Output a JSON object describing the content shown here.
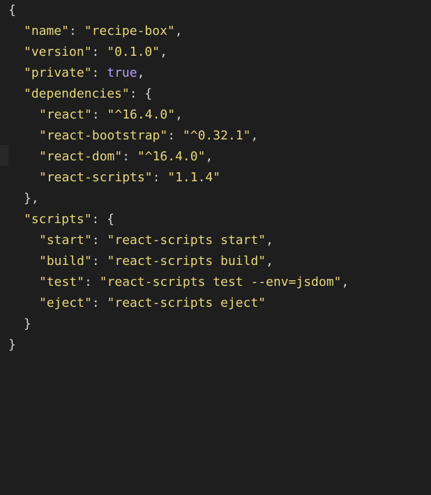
{
  "file": {
    "lines": [
      {
        "type": "brace_open",
        "text": "{"
      },
      {
        "type": "pair",
        "indent": 1,
        "key": "\"name\"",
        "value": "\"recipe-box\"",
        "comma": true
      },
      {
        "type": "pair",
        "indent": 1,
        "key": "\"version\"",
        "value": "\"0.1.0\"",
        "comma": true
      },
      {
        "type": "pair_bool",
        "indent": 1,
        "key": "\"private\"",
        "value": "true",
        "comma": true
      },
      {
        "type": "obj_open",
        "indent": 1,
        "key": "\"dependencies\""
      },
      {
        "type": "pair",
        "indent": 2,
        "key": "\"react\"",
        "value": "\"^16.4.0\"",
        "comma": true
      },
      {
        "type": "pair",
        "indent": 2,
        "key": "\"react-bootstrap\"",
        "value": "\"^0.32.1\"",
        "comma": true
      },
      {
        "type": "pair",
        "indent": 2,
        "key": "\"react-dom\"",
        "value": "\"^16.4.0\"",
        "comma": true
      },
      {
        "type": "pair",
        "indent": 2,
        "key": "\"react-scripts\"",
        "value": "\"1.1.4\"",
        "comma": false
      },
      {
        "type": "obj_close",
        "indent": 1,
        "text": "},",
        "comma": true
      },
      {
        "type": "obj_open",
        "indent": 1,
        "key": "\"scripts\""
      },
      {
        "type": "pair",
        "indent": 2,
        "key": "\"start\"",
        "value": "\"react-scripts start\"",
        "comma": true
      },
      {
        "type": "pair",
        "indent": 2,
        "key": "\"build\"",
        "value": "\"react-scripts build\"",
        "comma": true
      },
      {
        "type": "pair",
        "indent": 2,
        "key": "\"test\"",
        "value": "\"react-scripts test --env=jsdom\"",
        "comma": true
      },
      {
        "type": "pair",
        "indent": 2,
        "key": "\"eject\"",
        "value": "\"react-scripts eject\"",
        "comma": false
      },
      {
        "type": "obj_close",
        "indent": 1,
        "text": "}",
        "comma": false
      },
      {
        "type": "brace_close",
        "text": "}"
      }
    ]
  },
  "colors": {
    "background": "#1e1e1e",
    "key": "#e6d77a",
    "string": "#e6d77a",
    "boolean": "#b79dff",
    "punctuation": "#d4d4d4"
  }
}
